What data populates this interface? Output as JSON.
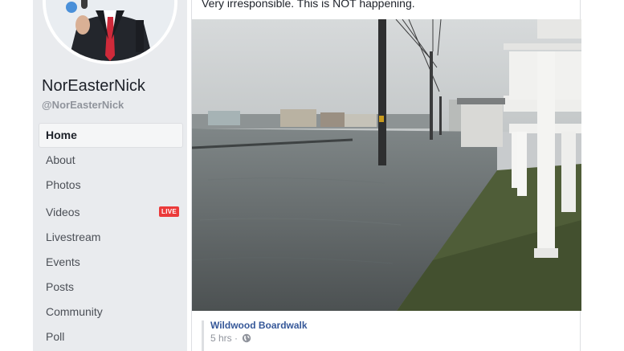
{
  "page": {
    "name": "NorEasterNick",
    "handle": "@NorEasterNick"
  },
  "nav": {
    "items": [
      {
        "label": "Home"
      },
      {
        "label": "About"
      },
      {
        "label": "Photos"
      },
      {
        "label": "Videos",
        "badge": "LIVE"
      },
      {
        "label": "Livestream"
      },
      {
        "label": "Events"
      },
      {
        "label": "Posts"
      },
      {
        "label": "Community"
      },
      {
        "label": "Poll"
      }
    ]
  },
  "post": {
    "text": "Very irresponsible. This is NOT happening.",
    "link_title": "Wildwood Boardwalk",
    "timestamp": "5 hrs",
    "separator": "·"
  },
  "colors": {
    "sidebar_bg": "#e9ebee",
    "link": "#365899",
    "live": "#eb3a3a"
  },
  "icons": [
    "globe-icon"
  ]
}
